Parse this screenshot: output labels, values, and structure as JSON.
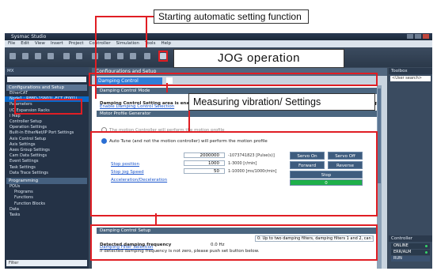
{
  "callouts": {
    "auto_setting": "Starting automatic setting function",
    "jog": "JOG operation",
    "vibration": "Measuring vibration/ Settings"
  },
  "app": {
    "title": "Sysmac Studio",
    "menu": [
      "File",
      "Edit",
      "View",
      "Insert",
      "Project",
      "Controller",
      "Simulation",
      "Tools",
      "Help"
    ]
  },
  "left_panel": {
    "header": "MX",
    "section_config": "Configurations and Setup",
    "items": [
      "EtherCAT",
      "Node1 : R88D-1SN01L-ECT (E001)",
      "Parameters",
      "I/O Expansion Racks",
      "I Map",
      "Controller Setup",
      "Operation Settings",
      "Built-in EtherNet/IP Port Settings",
      "Axis Control Setup",
      "Axis Settings",
      "Axes Group Settings",
      "Cam Data Settings",
      "Event Settings",
      "Task Settings",
      "Data Trace Settings"
    ],
    "selected_index": 1,
    "section_prog": "Programming",
    "prog_items": [
      "POUs",
      "Programs",
      "Functions",
      "Function Blocks",
      "Data",
      "Tasks"
    ],
    "side_tab": "Multiview Explorer",
    "filter": "Filter"
  },
  "document": {
    "header": "Configurations and Setup",
    "tab_label": "Damping Control",
    "damping_mode_title": "Damping Control Mode",
    "damping_mode_link": "Enable Damping Control Selection",
    "damping_mode_text": "Damping Control Setting area is enabled. Anti-vibration mode selection is available in both closed and open loop modes.",
    "motor_profile_title": "Motor Profile Generator",
    "radio_controller": "The motion Controller will perform the motion profile",
    "radio_autotune": "Auto Tune (and not the motion controller) will perform the motion profile",
    "autotune_selected": true,
    "params": [
      {
        "label": "Stop position",
        "value": "2000000",
        "unit": "-1073741823 [Pulse(s)]"
      },
      {
        "label": "Stop jog Speed",
        "value": "1000",
        "unit": "1-3000 [r/min]"
      },
      {
        "label": "Acceleration/Deceleration",
        "value": "50",
        "unit": "1-10000 [ms/1000r/min]"
      }
    ],
    "jog_buttons": {
      "servo_on": "Servo On",
      "servo_off": "Servo Off",
      "forward": "Forward",
      "reverse": "Reverse",
      "stop": "Stop",
      "counter": "0"
    },
    "damping_setup_title": "Damping Control Setup",
    "damping_filter_link": "Damping Filter Selection",
    "detected_label": "Detected damping frequency",
    "detected_value": "0.0 Hz",
    "detected_hint": "If detected damping frequency is not zero, please push set button below.",
    "filter_select": "0: Up to two damping filters, damping filters 1 and 2, can be used at the ..."
  },
  "right_panel": {
    "toolbox_title": "Toolbox",
    "search": "<User search>",
    "controller_title": "Controller",
    "status_online": "ONLINE",
    "status_errcalm": "ERR/ALM",
    "status_run": "RUN"
  },
  "colors": {
    "highlight": "#e01e24",
    "selection": "#0a68c8",
    "run_green": "#1fb04a"
  }
}
